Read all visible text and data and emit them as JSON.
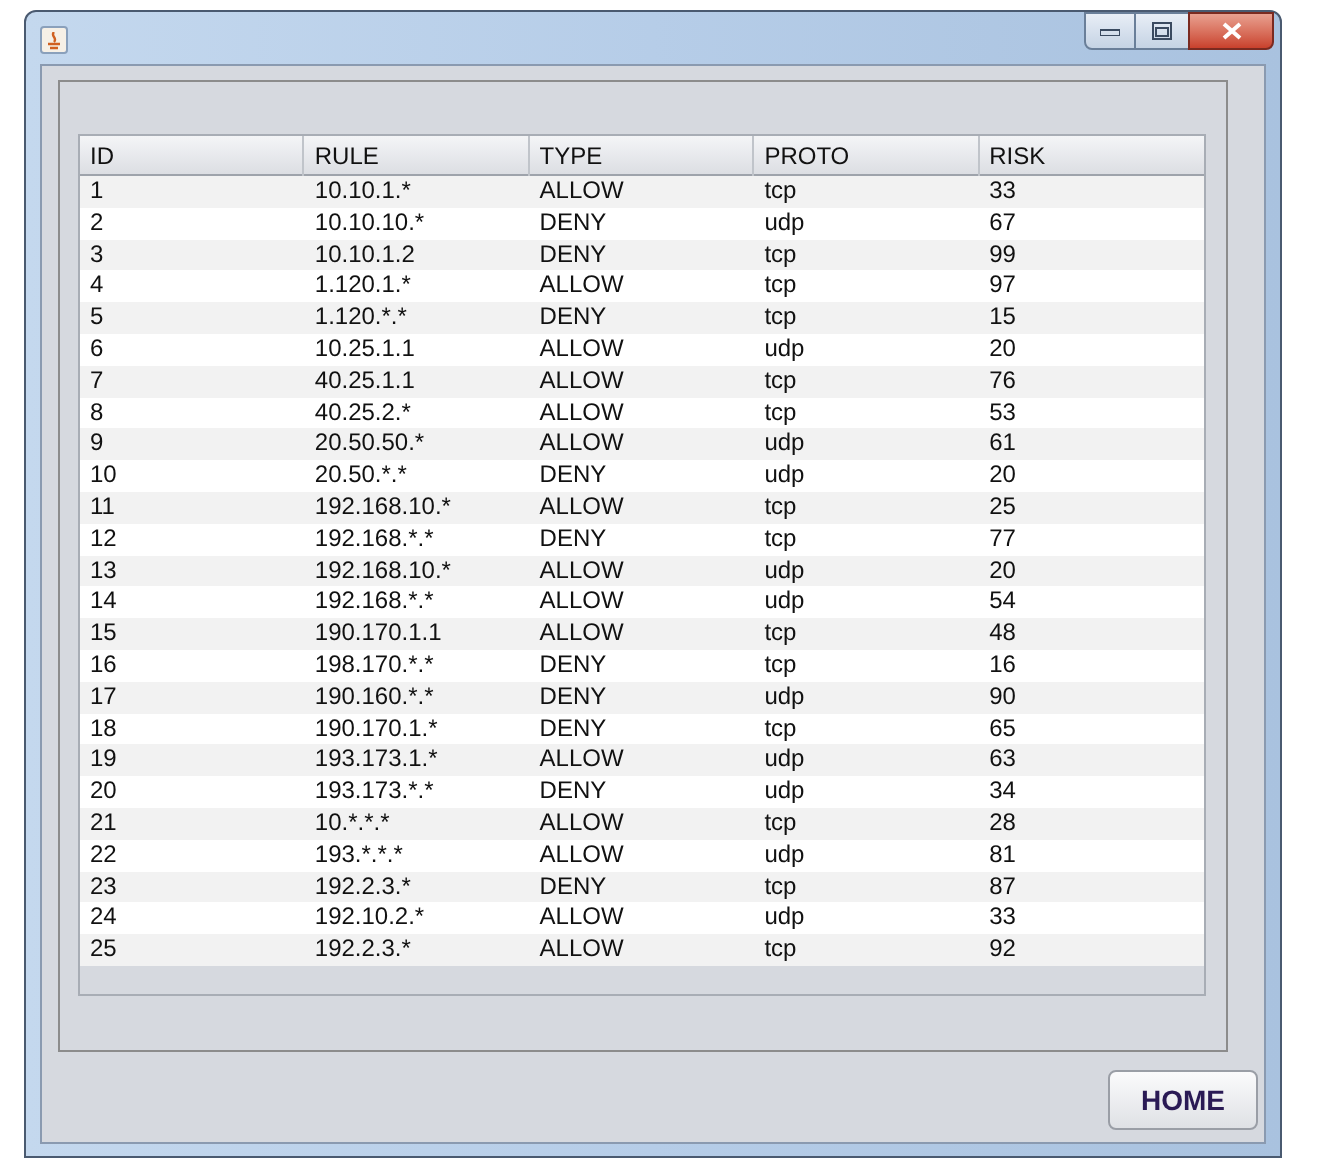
{
  "table": {
    "columns": [
      "ID",
      "RULE",
      "TYPE",
      "PROTO",
      "RISK"
    ],
    "rows": [
      [
        "1",
        "10.10.1.*",
        "ALLOW",
        "tcp",
        "33"
      ],
      [
        "2",
        "10.10.10.*",
        "DENY",
        "udp",
        "67"
      ],
      [
        "3",
        "10.10.1.2",
        "DENY",
        "tcp",
        "99"
      ],
      [
        "4",
        "1.120.1.*",
        "ALLOW",
        "tcp",
        "97"
      ],
      [
        "5",
        "1.120.*.*",
        "DENY",
        "tcp",
        "15"
      ],
      [
        "6",
        "10.25.1.1",
        "ALLOW",
        "udp",
        "20"
      ],
      [
        "7",
        "40.25.1.1",
        "ALLOW",
        "tcp",
        "76"
      ],
      [
        "8",
        "40.25.2.*",
        "ALLOW",
        "tcp",
        "53"
      ],
      [
        "9",
        "20.50.50.*",
        "ALLOW",
        "udp",
        "61"
      ],
      [
        "10",
        "20.50.*.*",
        "DENY",
        "udp",
        "20"
      ],
      [
        "11",
        "192.168.10.*",
        "ALLOW",
        "tcp",
        "25"
      ],
      [
        "12",
        "192.168.*.*",
        "DENY",
        "tcp",
        "77"
      ],
      [
        "13",
        "192.168.10.*",
        "ALLOW",
        "udp",
        "20"
      ],
      [
        "14",
        "192.168.*.*",
        "ALLOW",
        "udp",
        "54"
      ],
      [
        "15",
        "190.170.1.1",
        "ALLOW",
        "tcp",
        "48"
      ],
      [
        "16",
        "198.170.*.*",
        "DENY",
        "tcp",
        "16"
      ],
      [
        "17",
        "190.160.*.*",
        "DENY",
        "udp",
        "90"
      ],
      [
        "18",
        "190.170.1.*",
        "DENY",
        "tcp",
        "65"
      ],
      [
        "19",
        "193.173.1.*",
        "ALLOW",
        "udp",
        "63"
      ],
      [
        "20",
        "193.173.*.*",
        "DENY",
        "udp",
        "34"
      ],
      [
        "21",
        "10.*.*.*",
        "ALLOW",
        "tcp",
        "28"
      ],
      [
        "22",
        "193.*.*.*",
        "ALLOW",
        "udp",
        "81"
      ],
      [
        "23",
        "192.2.3.*",
        "DENY",
        "tcp",
        "87"
      ],
      [
        "24",
        "192.10.2.*",
        "ALLOW",
        "udp",
        "33"
      ],
      [
        "25",
        "192.2.3.*",
        "ALLOW",
        "tcp",
        "92"
      ]
    ]
  },
  "home_button": "HOME"
}
